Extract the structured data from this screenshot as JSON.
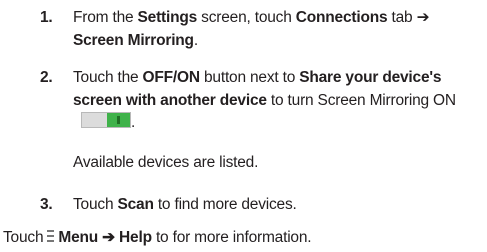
{
  "steps": [
    {
      "number": "1.",
      "parts": {
        "a": "From the ",
        "b": "Settings",
        "c": " screen, touch ",
        "d": "Connections",
        "e": " tab ➔",
        "f": "Screen Mirroring",
        "g": "."
      }
    },
    {
      "number": "2.",
      "parts": {
        "a": "Touch the ",
        "b": "OFF/ON",
        "c": " button next to ",
        "d": "Share your device's screen with another device",
        "e": " to turn Screen Mirroring ON",
        "f": "."
      }
    },
    {
      "number": "3.",
      "parts": {
        "a": "Touch ",
        "b": "Scan",
        "c": " to find more devices."
      }
    }
  ],
  "note": "Available devices are listed.",
  "footer": {
    "a": "Touch",
    "b": "Menu ➔ Help",
    "c": " to for more information."
  },
  "icons": {
    "toggle": "on-off-toggle-icon",
    "menu": "menu-icon"
  },
  "colors": {
    "toggle_on": "#3fb24a"
  }
}
